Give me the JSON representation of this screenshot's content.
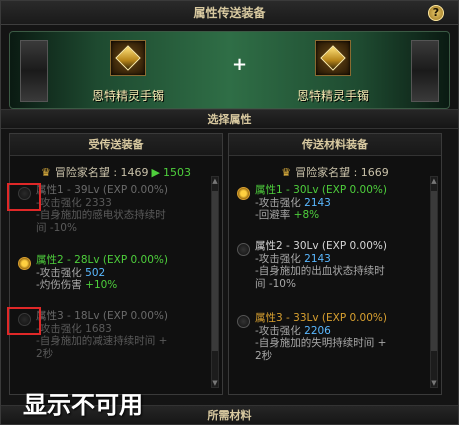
{
  "window": {
    "title": "属性传送装备"
  },
  "banner": {
    "left_item": "恩特精灵手镯",
    "right_item": "恩特精灵手镯",
    "plus": "+"
  },
  "section_select": "选择属性",
  "section_materials": "所需材料",
  "left_panel": {
    "title": "受传送装备",
    "fame_label": "冒险家名望 : 1469",
    "fame_new": "1503",
    "attrs": [
      {
        "head": "属性1 - 39Lv (EXP 0.00%)",
        "lines": [
          "-攻击强化 ",
          "-自身施加的感电状态持续时",
          "间 -10%"
        ],
        "num": "2333",
        "state": "disabled"
      },
      {
        "head": "属性2 - 28Lv (EXP 0.00%)",
        "lines": [
          "-攻击强化 ",
          "-灼伤伤害 "
        ],
        "num": "502",
        "extra": "+10%",
        "state": "selected"
      },
      {
        "head": "属性3 - 18Lv (EXP 0.00%)",
        "lines": [
          "-攻击强化 ",
          "-自身施加的减速持续时间 +",
          "2秒"
        ],
        "num": "1683",
        "state": "disabled"
      }
    ]
  },
  "right_panel": {
    "title": "传送材料装备",
    "fame_label": "冒险家名望 : 1669",
    "attrs": [
      {
        "head": "属性1 - 30Lv (EXP 0.00%)",
        "lines": [
          "-攻击强化 ",
          "-回避率 "
        ],
        "num": "2143",
        "extra": "+8%",
        "state": "selected"
      },
      {
        "head": "属性2 - 30Lv (EXP 0.00%)",
        "lines": [
          "-攻击强化 ",
          "-自身施加的出血状态持续时",
          "间 -10%"
        ],
        "num": "2143",
        "state": "normal"
      },
      {
        "head": "属性3 - 33Lv (EXP 0.00%)",
        "lines": [
          "-攻击强化 ",
          "-自身施加的失明持续时间 +",
          "2秒"
        ],
        "num": "2206",
        "state": "normal"
      }
    ]
  },
  "overlay_caption": "显示不可用",
  "help_label": "?",
  "colors": {
    "green": "#4ecf3c",
    "blue": "#5ab8ff",
    "gold": "#d8a030",
    "highlight": "#e02828"
  }
}
